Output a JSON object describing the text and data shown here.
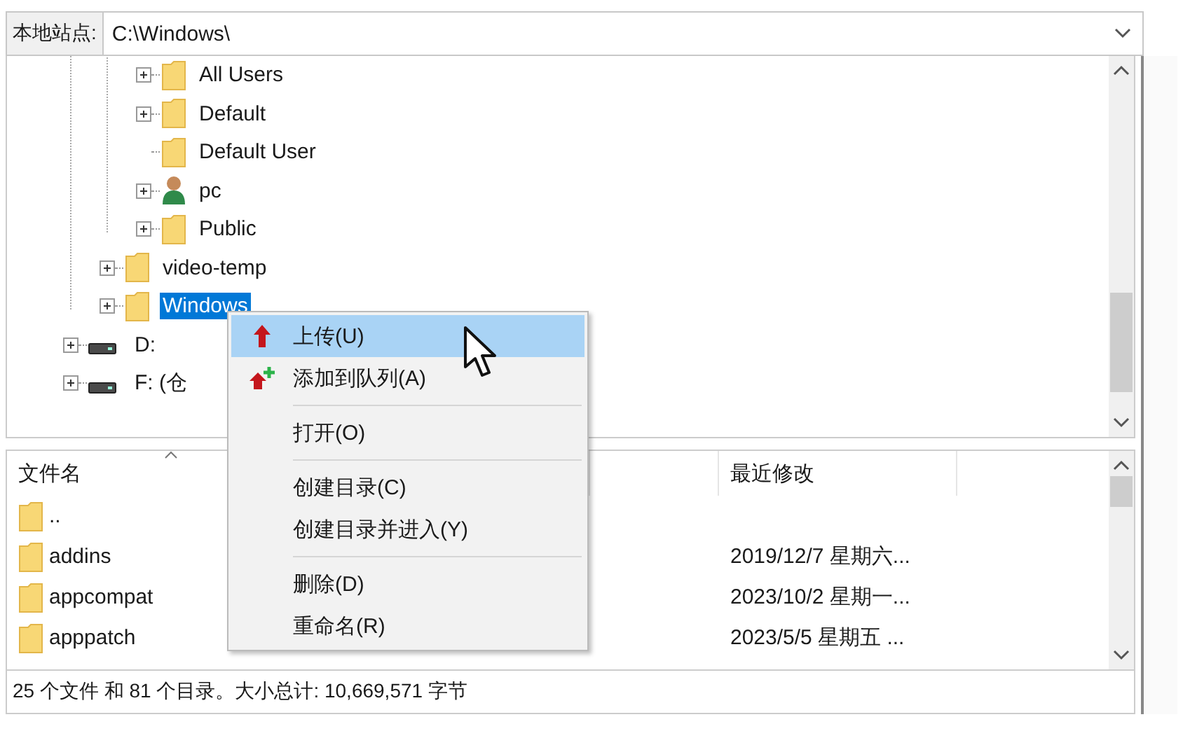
{
  "site_bar": {
    "label": "本地站点:",
    "path": "C:\\Windows\\"
  },
  "tree": {
    "items": [
      {
        "kind": "hidden",
        "children": [
          {
            "kind": "hidden",
            "children": [
              {
                "kind": "folder",
                "label": "All Users",
                "has_children": true,
                "selected": false
              },
              {
                "kind": "folder",
                "label": "Default",
                "has_children": true,
                "selected": false
              },
              {
                "kind": "folder",
                "label": "Default User",
                "has_children": false,
                "selected": false
              },
              {
                "kind": "user",
                "label": "pc",
                "has_children": true,
                "selected": false
              },
              {
                "kind": "folder",
                "label": "Public",
                "has_children": true,
                "selected": false
              }
            ]
          },
          {
            "kind": "folder",
            "label": "video-temp",
            "has_children": true,
            "selected": false
          },
          {
            "kind": "folder",
            "label": "Windows",
            "has_children": true,
            "selected": true
          }
        ]
      },
      {
        "kind": "drive",
        "label": "D:",
        "has_children": true,
        "selected": false
      },
      {
        "kind": "drive",
        "label": "F: (仓",
        "has_children": true,
        "selected": false
      }
    ]
  },
  "file_list": {
    "columns": [
      {
        "label": "文件名",
        "sorted": true
      },
      {
        "label": "最近修改",
        "sorted": false
      }
    ],
    "rows": [
      {
        "name": ".."
      },
      {
        "name": "addins",
        "modified": "2019/12/7 星期六..."
      },
      {
        "name": "appcompat",
        "modified": "2023/10/2 星期一..."
      },
      {
        "name": "apppatch",
        "modified": "2023/5/5 星期五 ..."
      }
    ]
  },
  "status_bar": "25 个文件 和 81 个目录。大小总计: 10,669,571 字节",
  "context_menu": [
    {
      "kind": "upload",
      "label": "上传(U)",
      "highlighted": true
    },
    {
      "kind": "queue",
      "label": "添加到队列(A)",
      "highlighted": false
    },
    {
      "kind": "separator"
    },
    {
      "kind": "plain",
      "label": "打开(O)",
      "highlighted": false
    },
    {
      "kind": "separator"
    },
    {
      "kind": "plain",
      "label": "创建目录(C)",
      "highlighted": false
    },
    {
      "kind": "plain",
      "label": "创建目录并进入(Y)",
      "highlighted": false
    },
    {
      "kind": "separator"
    },
    {
      "kind": "plain",
      "label": "删除(D)",
      "highlighted": false
    },
    {
      "kind": "plain",
      "label": "重命名(R)",
      "highlighted": false
    }
  ]
}
